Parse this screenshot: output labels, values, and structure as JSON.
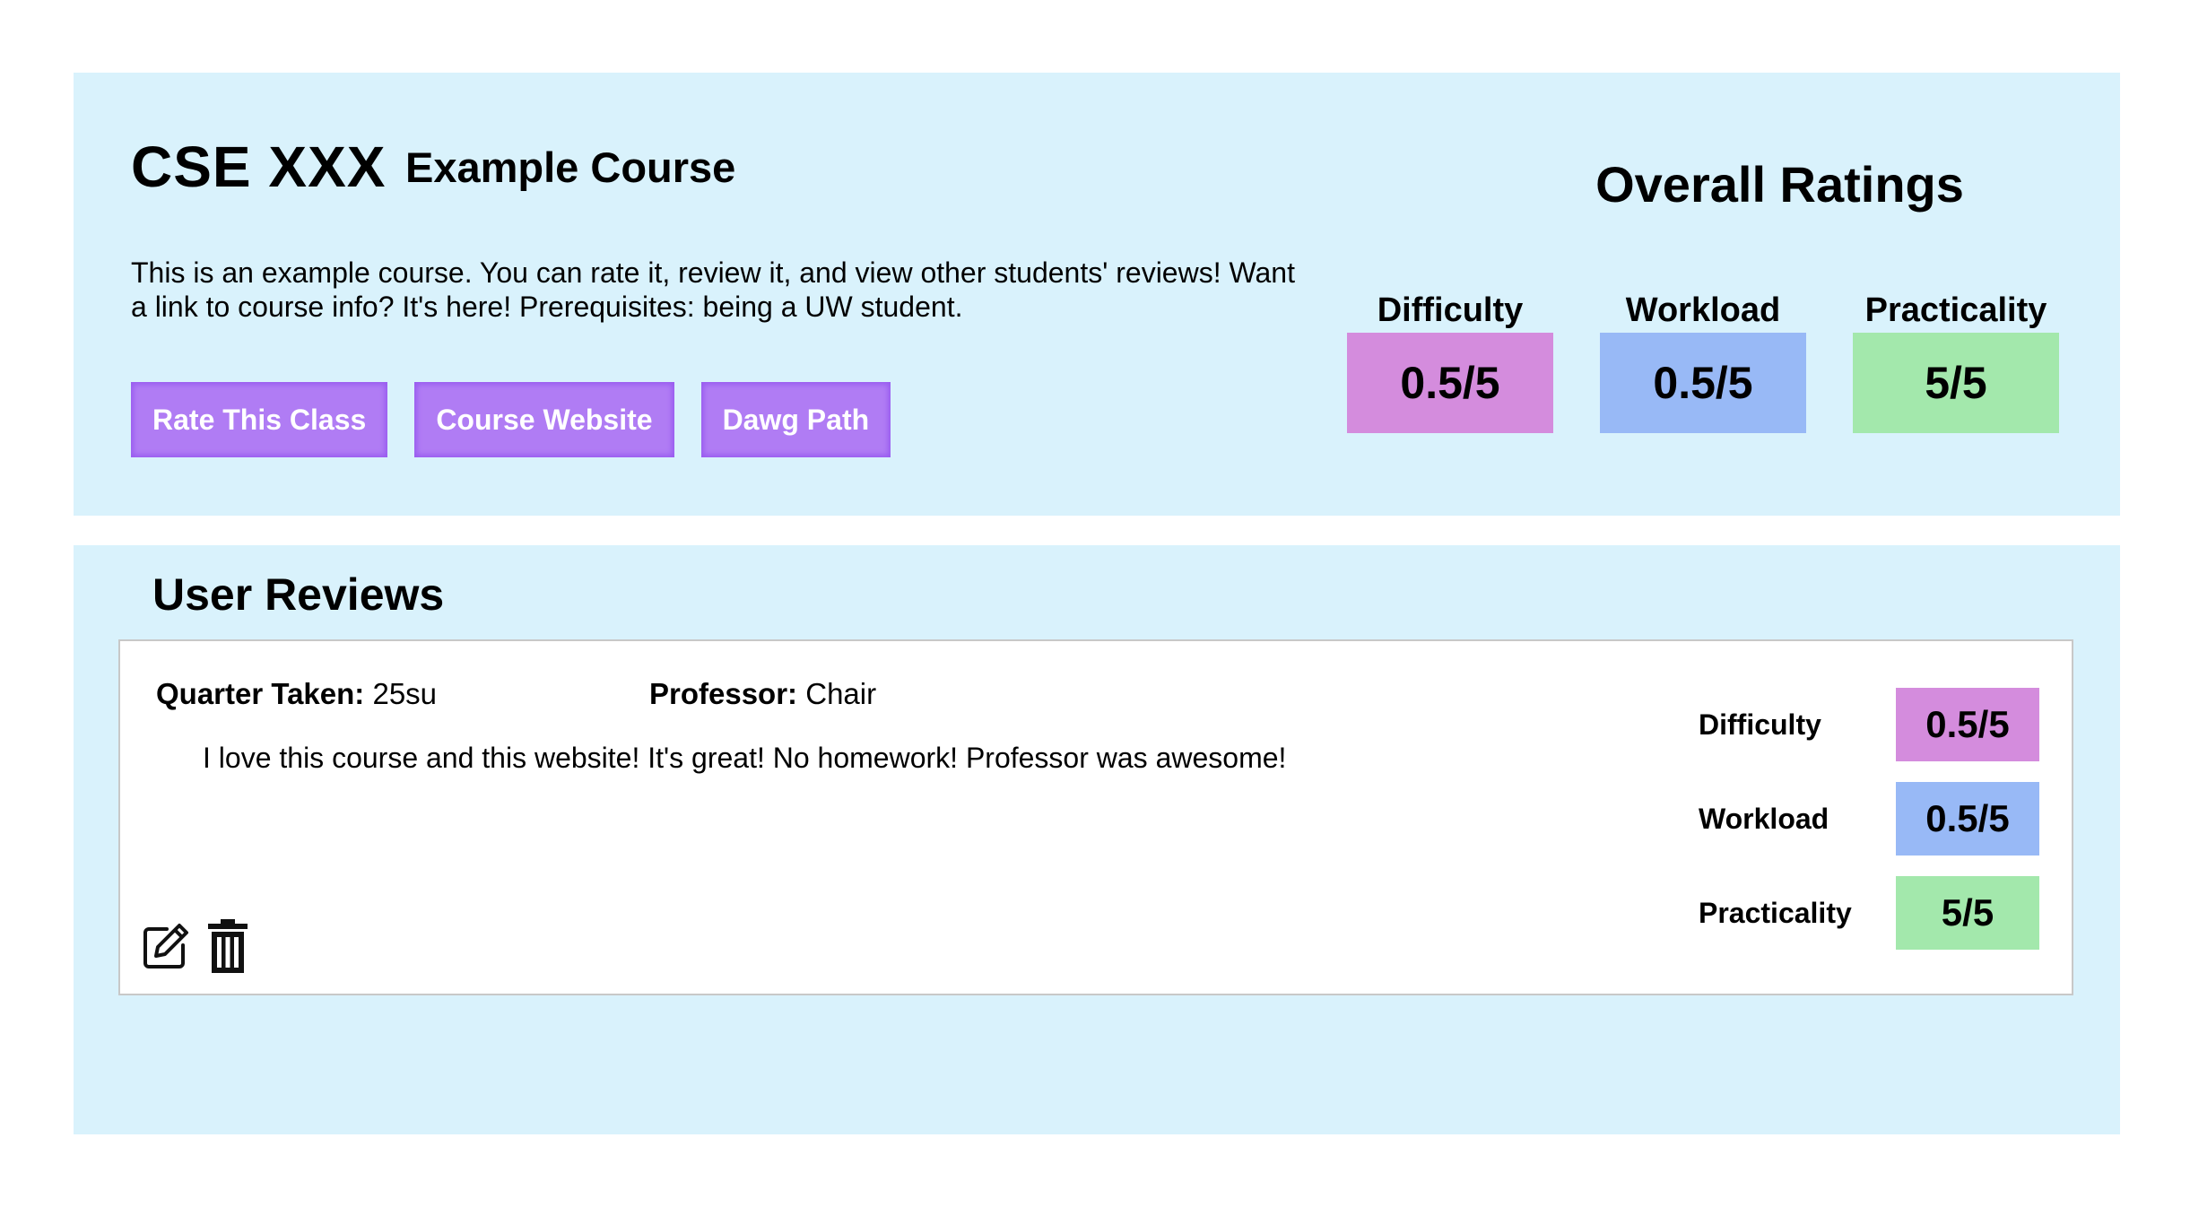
{
  "course": {
    "code": "CSE XXX",
    "name": "Example Course",
    "description": "This is an example course. You can rate it, review it, and view other students' reviews! Want a link to course info? It's here! Prerequisites: being a UW student.",
    "buttons": {
      "rate": "Rate This Class",
      "website": "Course Website",
      "dawg_path": "Dawg Path"
    }
  },
  "overall": {
    "title": "Overall Ratings",
    "metrics": [
      {
        "label": "Difficulty",
        "value": "0.5/5",
        "color": "#d48cdd"
      },
      {
        "label": "Workload",
        "value": "0.5/5",
        "color": "#98b9f6"
      },
      {
        "label": "Practicality",
        "value": "5/5",
        "color": "#a3e8ac"
      }
    ]
  },
  "reviews": {
    "title": "User Reviews",
    "items": [
      {
        "quarter_label": "Quarter Taken:",
        "quarter": "25su",
        "professor_label": "Professor:",
        "professor": "Chair",
        "text": "I love this course and this website! It's great! No homework! Professor was awesome!",
        "ratings": [
          {
            "label": "Difficulty",
            "value": "0.5/5",
            "color": "#d48cdd"
          },
          {
            "label": "Workload",
            "value": "0.5/5",
            "color": "#98b9f6"
          },
          {
            "label": "Practicality",
            "value": "5/5",
            "color": "#a3e8ac"
          }
        ],
        "actions": [
          "edit-icon",
          "trash-icon"
        ]
      }
    ]
  },
  "colors": {
    "panel_bg": "#d9f2fc",
    "button_bg": "#b07cf4"
  }
}
